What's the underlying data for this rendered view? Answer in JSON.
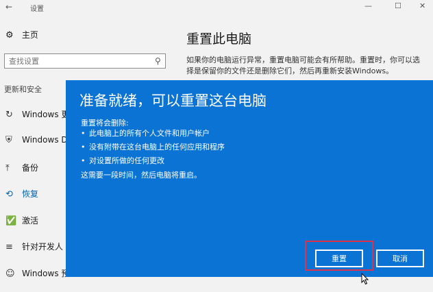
{
  "window": {
    "title": "设置",
    "back_icon": "back-arrow-icon"
  },
  "sidebar": {
    "home_label": "主页",
    "search_placeholder": "查找设置",
    "section_title": "更新和安全",
    "items": [
      {
        "label": "Windows 更",
        "icon": "refresh-icon"
      },
      {
        "label": "Windows D",
        "icon": "shield-icon"
      },
      {
        "label": "备份",
        "icon": "backup-arrow-icon"
      },
      {
        "label": "恢复",
        "icon": "recovery-icon",
        "active": true
      },
      {
        "label": "激活",
        "icon": "check-circle-icon"
      },
      {
        "label": "针对开发人",
        "icon": "developer-icon"
      },
      {
        "label": "Windows 预",
        "icon": "windows-insider-icon"
      }
    ]
  },
  "main": {
    "title": "重置此电脑",
    "description": "如果你的电脑运行异常，重置电脑可能会有所帮助。重置时，你可以选择是保留你的文件还是删除它们，然后再重新安装Windows。"
  },
  "dialog": {
    "heading": "准备就绪，可以重置这台电脑",
    "intro": "重置将会删除:",
    "items": [
      "此电脑上的所有个人文件和用户帐户",
      "没有附带在这台电脑上的任何应用和程序",
      "对设置所做的任何更改"
    ],
    "note": "这需要一段时间，然后电脑将重启。",
    "reset_label": "重置",
    "cancel_label": "取消"
  },
  "colors": {
    "dialog_bg": "#0a73d4",
    "accent": "#0063b1",
    "highlight": "#e0314b"
  }
}
